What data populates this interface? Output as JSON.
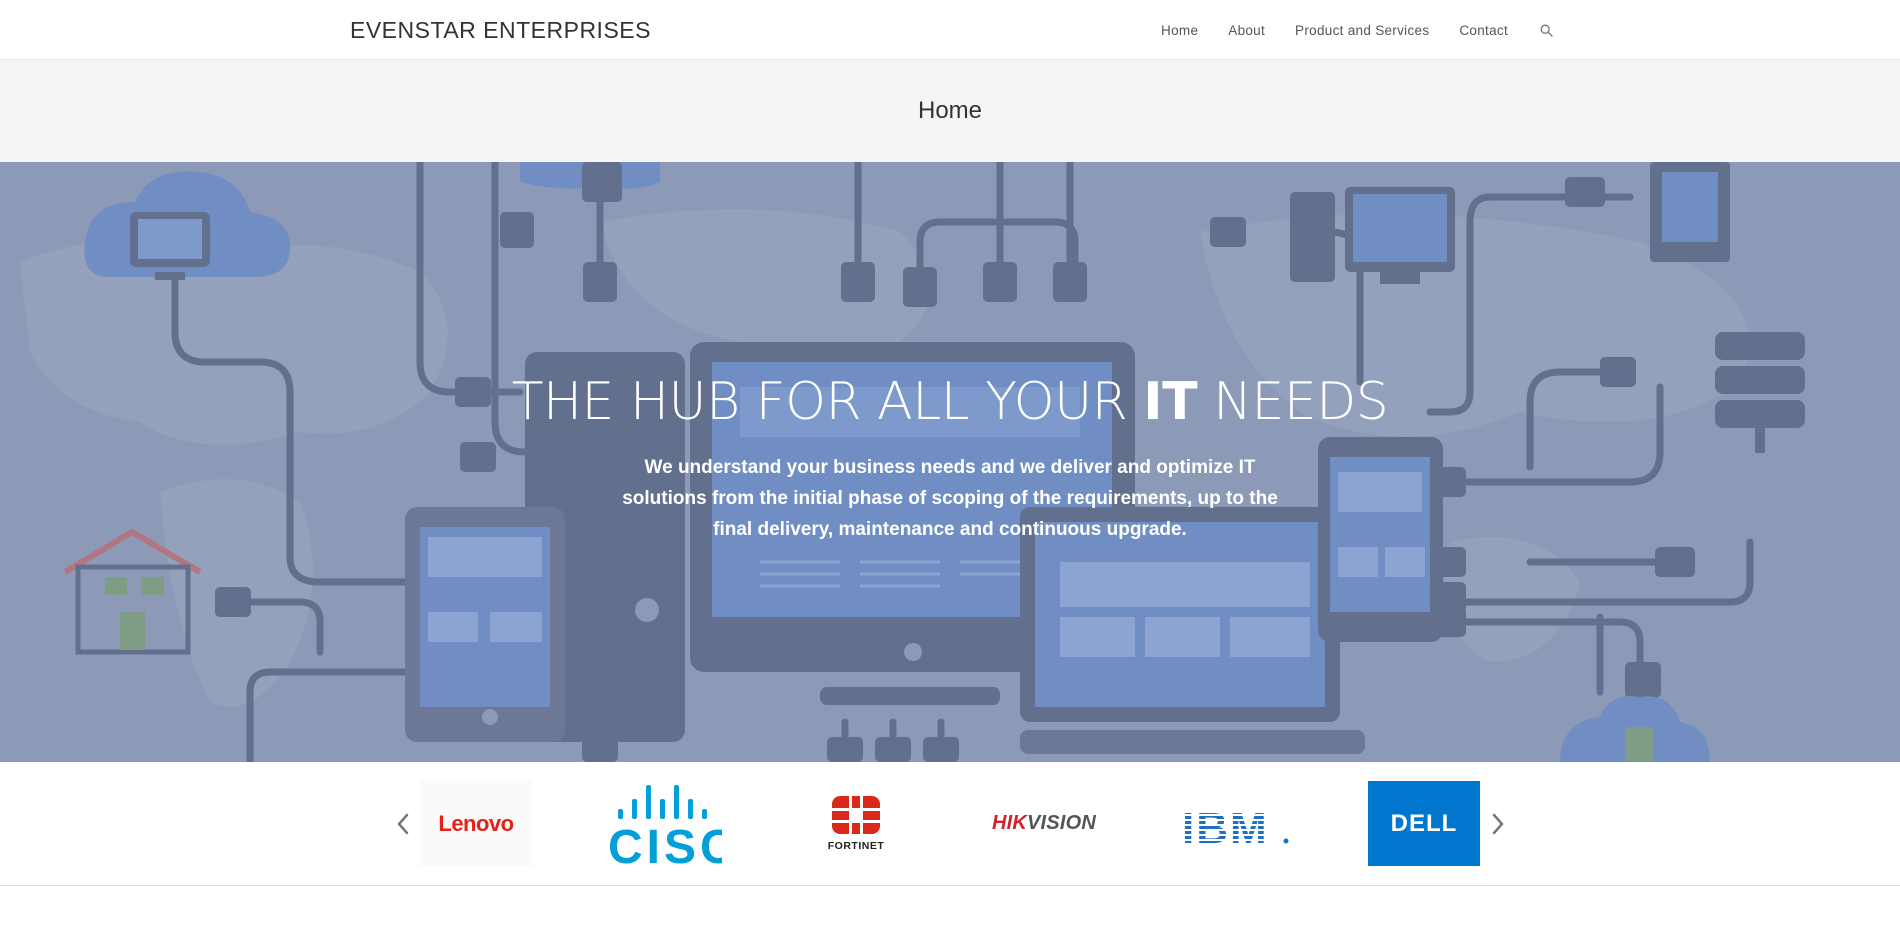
{
  "header": {
    "brand": "EVENSTAR ENTERPRISES",
    "nav": [
      "Home",
      "About",
      "Product and Services",
      "Contact"
    ],
    "search_icon": "search-icon"
  },
  "title_bar": {
    "title": "Home"
  },
  "hero": {
    "title_part1": "THE HUB FOR ALL YOUR ",
    "title_strong": "IT",
    "title_part2": " NEEDS",
    "text": "We understand your business needs and we deliver and optimize IT solutions from the initial phase of scoping of the requirements, up to the final delivery, maintenance and continuous upgrade."
  },
  "carousel": {
    "prev_icon": "chevron-left-icon",
    "next_icon": "chevron-right-icon",
    "logos": {
      "lenovo": "Lenovo",
      "cisco": "CISCO",
      "fortinet": "FORTINET",
      "hikvision_red": "HIK",
      "hikvision_rest": "VISION",
      "ibm": "IBM",
      "dell": "DELL"
    }
  },
  "colors": {
    "hero_bg": "#8f9db9",
    "device_dark": "#5f6b89",
    "screen_blue": "#6f8fc6",
    "title_bar_bg": "#f5f5f5",
    "cisco_blue": "#049fd9",
    "ibm_blue": "#1f70c1",
    "dell_blue": "#0076ce",
    "lenovo_red": "#e2231a",
    "fortinet_red": "#da291c"
  }
}
